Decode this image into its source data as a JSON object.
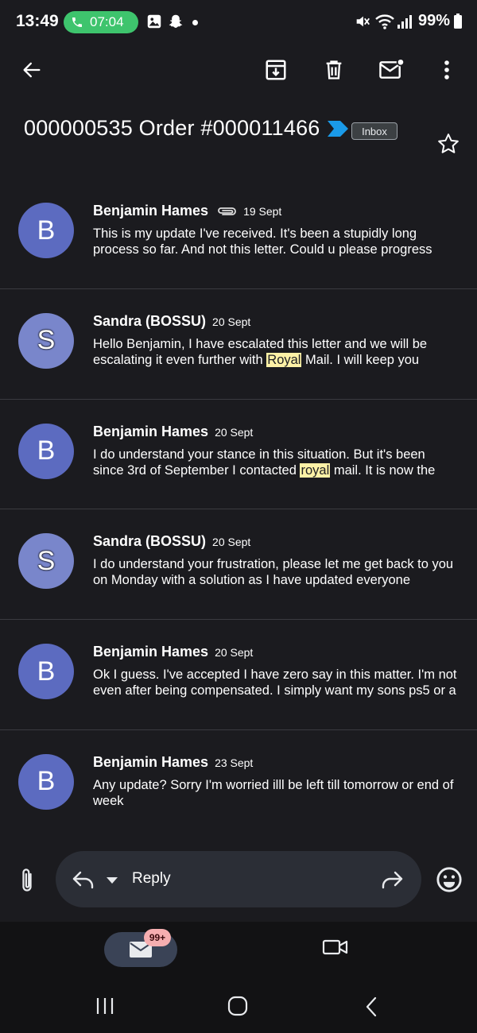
{
  "status_bar": {
    "time": "13:49",
    "call_timer": "07:04",
    "battery": "99%",
    "call_color": "#3ec46d"
  },
  "toolbar": {
    "back_icon": "arrow-left-icon",
    "archive_icon": "archive-icon",
    "delete_icon": "trash-icon",
    "unread_icon": "mark-unread-icon",
    "more_icon": "more-vert-icon"
  },
  "thread": {
    "subject": "000000535 Order #000011466",
    "label": "Inbox",
    "importance_color": "#1a9ae8"
  },
  "messages": [
    {
      "avatar": "B",
      "sender": "Benjamin Hames",
      "has_attachment": true,
      "date": "19 Sept",
      "snippet_parts": [
        "This is my update I've received. It's been a stupidly long process so far. And not this letter. Could u please progress"
      ],
      "highlight": ""
    },
    {
      "avatar": "S",
      "sender": "Sandra (BOSSU)",
      "has_attachment": false,
      "date": "20 Sept",
      "snippet_before": "Hello Benjamin, I have escalated this letter and we will be escalating it even further with ",
      "highlight": "Royal",
      "snippet_after": " Mail. I will keep you"
    },
    {
      "avatar": "B",
      "sender": "Benjamin Hames",
      "has_attachment": false,
      "date": "20 Sept",
      "snippet_before": "I do understand your stance in this situation. But it's been since 3rd of September I contacted ",
      "highlight": "royal",
      "snippet_after": " mail. It is now the"
    },
    {
      "avatar": "S",
      "sender": "Sandra (BOSSU)",
      "has_attachment": false,
      "date": "20 Sept",
      "snippet_parts": [
        "I do understand your frustration, please let me get back to you on Monday with a solution as I have updated everyone"
      ],
      "highlight": ""
    },
    {
      "avatar": "B",
      "sender": "Benjamin Hames",
      "has_attachment": false,
      "date": "20 Sept",
      "snippet_parts": [
        "Ok I guess. I've accepted I have zero say in this matter. I'm not even after being compensated. I simply want my sons ps5 or a"
      ],
      "highlight": ""
    },
    {
      "avatar": "B",
      "sender": "Benjamin Hames",
      "has_attachment": false,
      "date": "23 Sept",
      "snippet_parts": [
        "Any update? Sorry I'm worried illl be left till tomorrow or end of week"
      ],
      "highlight": ""
    }
  ],
  "reply_bar": {
    "reply_label": "Reply"
  },
  "bottom_nav": {
    "mail_badge": "99+"
  }
}
